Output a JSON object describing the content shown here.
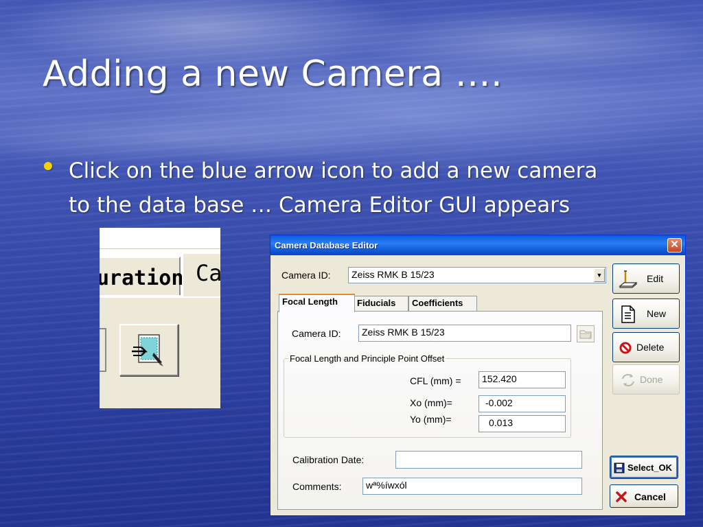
{
  "slide": {
    "title": "Adding a new Camera ….",
    "bullet_line1": "Click on the blue arrow icon to add a new camera",
    "bullet_line2": "to the data base … Camera Editor GUI appears"
  },
  "snippet": {
    "tab_partial_left": "uration",
    "tab_partial_right": "Ca"
  },
  "dialog": {
    "title": "Camera Database Editor",
    "close_glyph": "✕",
    "top_camera_label": "Camera ID:",
    "top_camera_value": "Zeiss RMK B 15/23",
    "tabs": [
      {
        "label": "Focal Length"
      },
      {
        "label": "Fiducials"
      },
      {
        "label": "Coefficients"
      }
    ],
    "inner_camera_label": "Camera ID:",
    "inner_camera_value": "Zeiss RMK B 15/23",
    "group_label": "Focal Length and Principle Point Offset",
    "cfl_label": "CFL (mm) =",
    "cfl_value": "152.420",
    "xo_label": "Xo (mm)=",
    "xo_value": "-0.002",
    "yo_label": "Yo (mm)=",
    "yo_value": "0.013",
    "calibration_label": "Calibration Date:",
    "calibration_value": "",
    "comments_label": "Comments:",
    "comments_value": "wª%íwxól",
    "buttons": {
      "edit": "Edit",
      "new": "New",
      "delete": "Delete",
      "done": "Done",
      "select_ok": "Select_OK",
      "cancel": "Cancel"
    }
  },
  "colors": {
    "bullet": "#f5d000",
    "titlebar": "#0a5bd8",
    "dialog_face": "#ece9d8"
  }
}
